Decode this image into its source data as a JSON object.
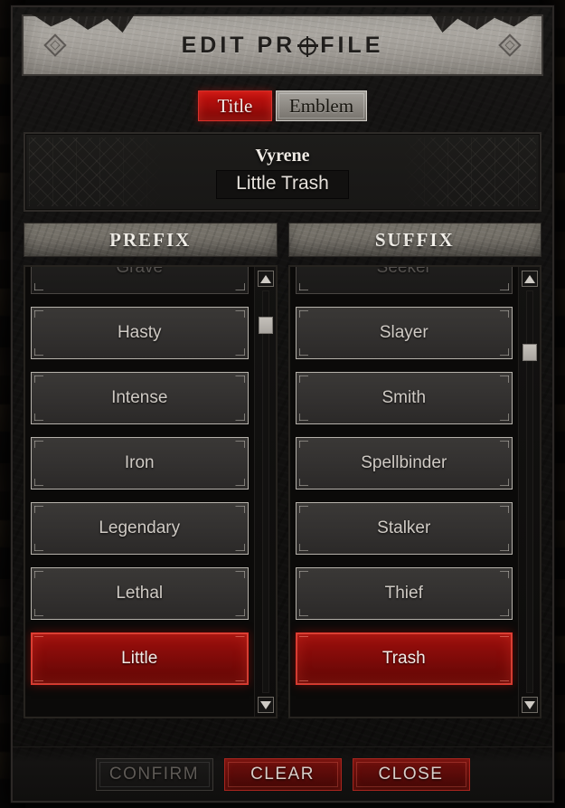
{
  "window": {
    "title": "EDIT PR⊕FILE",
    "title_plain": "EDIT PROFILE",
    "title_part_1": "EDIT PR",
    "title_part_2": "FILE"
  },
  "tabs": [
    {
      "label": "Title",
      "active": true
    },
    {
      "label": "Emblem",
      "active": false
    }
  ],
  "preview": {
    "character_name": "Vyrene",
    "composed_title": "Little Trash"
  },
  "prefix_column": {
    "header": "PREFIX",
    "items": [
      {
        "label": "Grave",
        "state": "clipped"
      },
      {
        "label": "Hasty",
        "state": "normal"
      },
      {
        "label": "Intense",
        "state": "normal"
      },
      {
        "label": "Iron",
        "state": "normal"
      },
      {
        "label": "Legendary",
        "state": "normal"
      },
      {
        "label": "Lethal",
        "state": "normal"
      },
      {
        "label": "Little",
        "state": "selected"
      }
    ],
    "scroll": {
      "up_arrow": "▲",
      "down_arrow": "▼",
      "thumb_position_pct": 12
    }
  },
  "suffix_column": {
    "header": "SUFFIX",
    "items": [
      {
        "label": "Seeker",
        "state": "clipped"
      },
      {
        "label": "Slayer",
        "state": "normal"
      },
      {
        "label": "Smith",
        "state": "normal"
      },
      {
        "label": "Spellbinder",
        "state": "normal"
      },
      {
        "label": "Stalker",
        "state": "normal"
      },
      {
        "label": "Thief",
        "state": "normal"
      },
      {
        "label": "Trash",
        "state": "selected"
      }
    ],
    "scroll": {
      "up_arrow": "▲",
      "down_arrow": "▼",
      "thumb_position_pct": 19
    }
  },
  "footer": {
    "buttons": [
      {
        "label": "CONFIRM",
        "style": "disabled"
      },
      {
        "label": "CLEAR",
        "style": "danger"
      },
      {
        "label": "CLOSE",
        "style": "danger"
      }
    ]
  },
  "colors": {
    "accent_red": "#a50d0b",
    "selected_red": "#9e100d",
    "danger_red": "#6f100d",
    "stone_light": "#a7a39d",
    "panel_dark": "#121110",
    "text_light": "#cfcac4"
  }
}
